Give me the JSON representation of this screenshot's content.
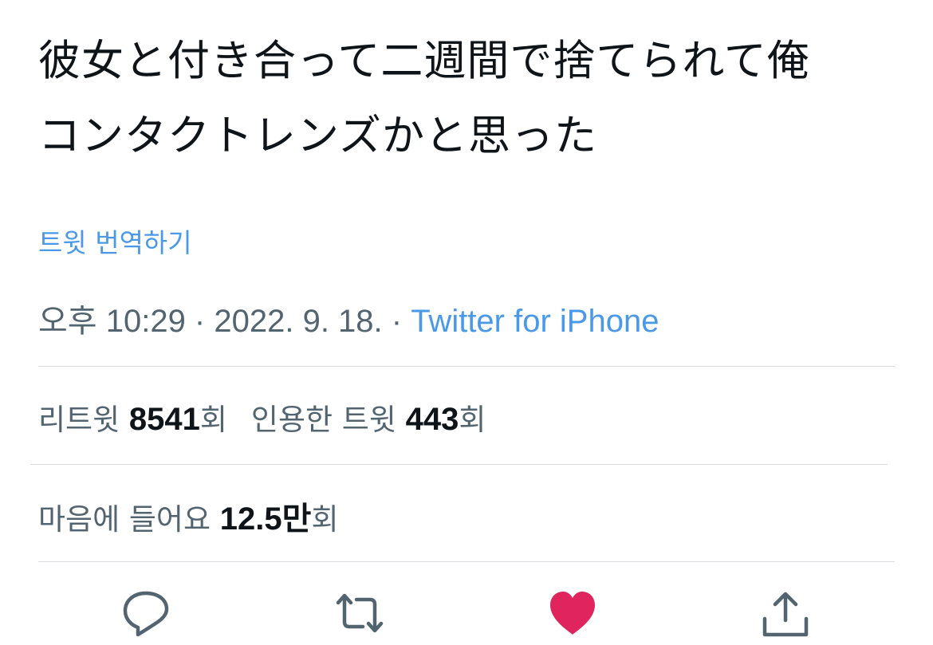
{
  "tweet": {
    "line1": "彼女と付き合って二週間で捨てられて俺",
    "line2": "コンタクトレンズかと思った"
  },
  "translate_link": "트윗 번역하기",
  "meta": {
    "time": "오후 10:29",
    "sep1": " · ",
    "date": "2022. 9. 18.",
    "sep2": " · ",
    "source": "Twitter for iPhone"
  },
  "stats": {
    "retweet_label": "리트윗 ",
    "retweet_count": "8541",
    "retweet_unit": "회",
    "quote_label": "인용한 트윗 ",
    "quote_count": "443",
    "quote_unit": "회",
    "like_label": "마음에 들어요 ",
    "like_count": "12.5",
    "like_count_unit": "만",
    "like_unit": "회"
  },
  "actions": [
    {
      "icon": "reply-icon",
      "state": "default"
    },
    {
      "icon": "retweet-icon",
      "state": "default"
    },
    {
      "icon": "heart-icon",
      "state": "liked",
      "color": "#e0245e"
    },
    {
      "icon": "share-icon",
      "state": "default"
    }
  ],
  "colors": {
    "link": "#4a99e9",
    "secondary_text": "#536471",
    "primary_text": "#0f1419",
    "like": "#e0245e",
    "divider": "#d9dde1"
  }
}
